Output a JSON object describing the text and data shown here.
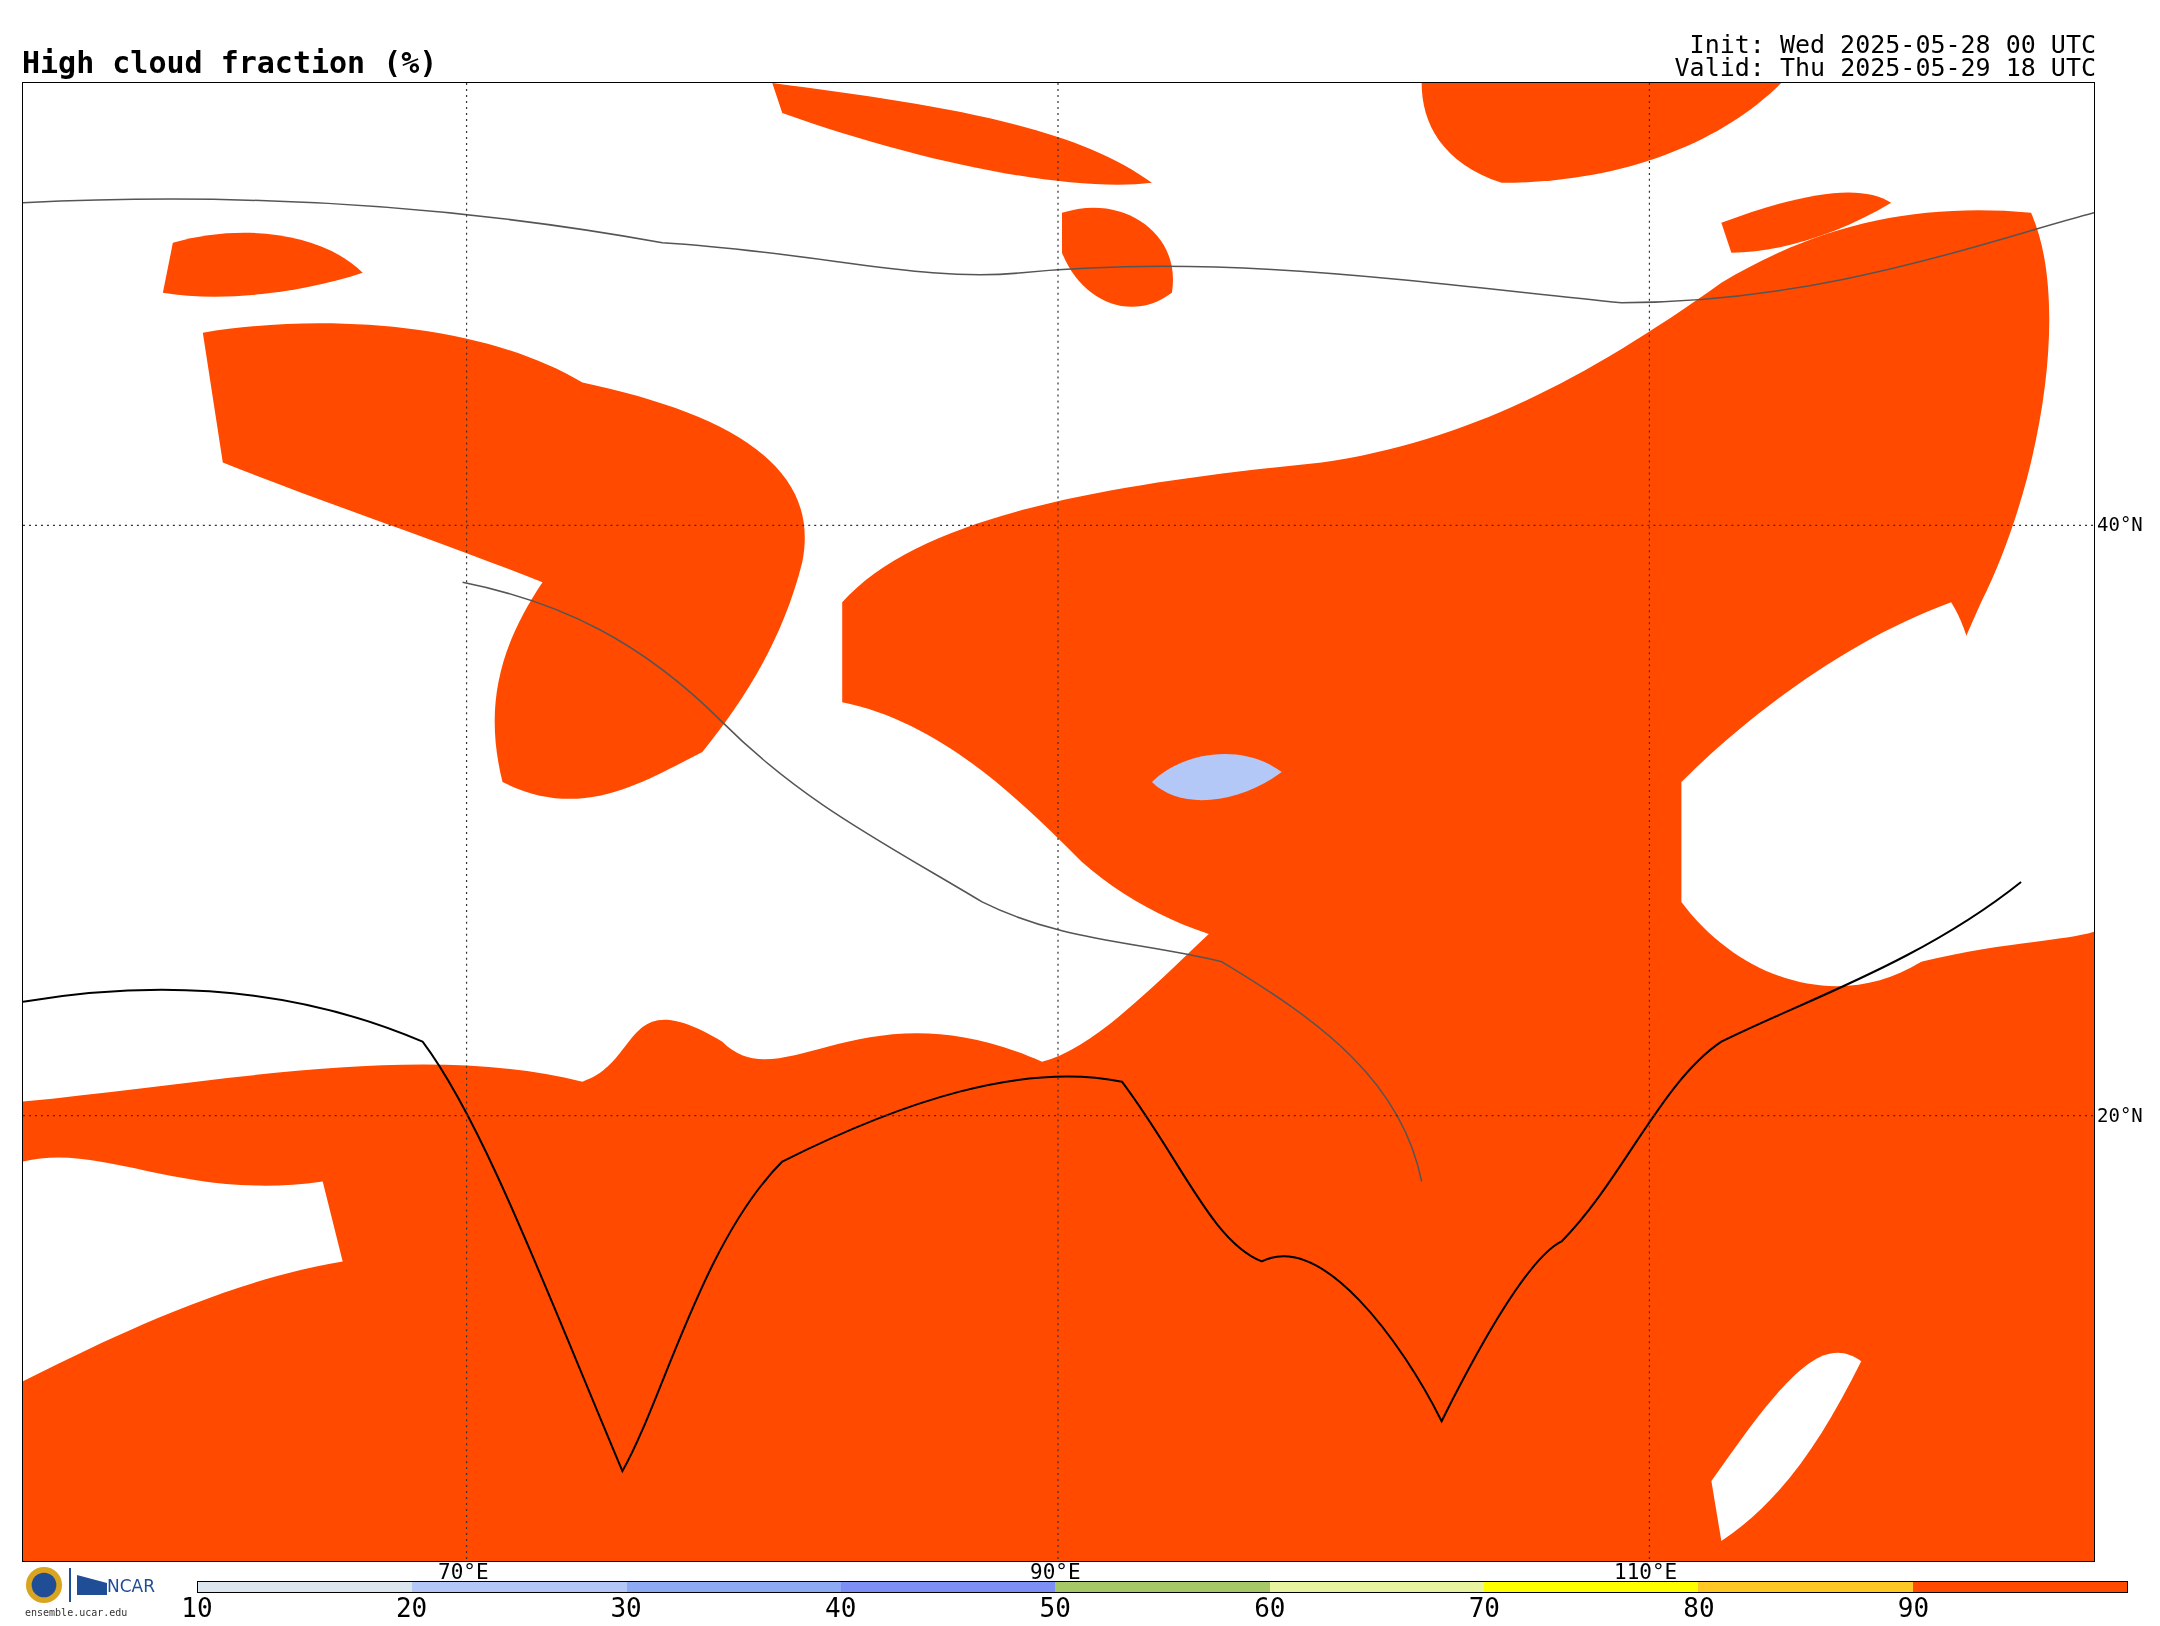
{
  "title": "High cloud fraction (%)",
  "run_info": [
    "Init: Wed 2025-05-28 00 UTC",
    "Valid: Thu 2025-05-29 18 UTC"
  ],
  "map": {
    "latitude_labels": [
      "40°N",
      "20°N"
    ],
    "longitude_labels": [
      "70°E",
      "90°E",
      "110°E"
    ]
  },
  "colorbar": {
    "ticks": [
      "10",
      "20",
      "30",
      "40",
      "50",
      "60",
      "70",
      "80",
      "90"
    ],
    "segments": [
      {
        "color": "#dce6ef"
      },
      {
        "color": "#b4c8f7"
      },
      {
        "color": "#8eaaf5"
      },
      {
        "color": "#7d8ff4"
      },
      {
        "color": "#a6c866"
      },
      {
        "color": "#e8f4a0"
      },
      {
        "color": "#ffff00"
      },
      {
        "color": "#ffc824"
      },
      {
        "color": "#ff4a00"
      }
    ]
  },
  "footer": {
    "logo_text": "NCAR",
    "site": "ensemble.ucar.edu"
  }
}
